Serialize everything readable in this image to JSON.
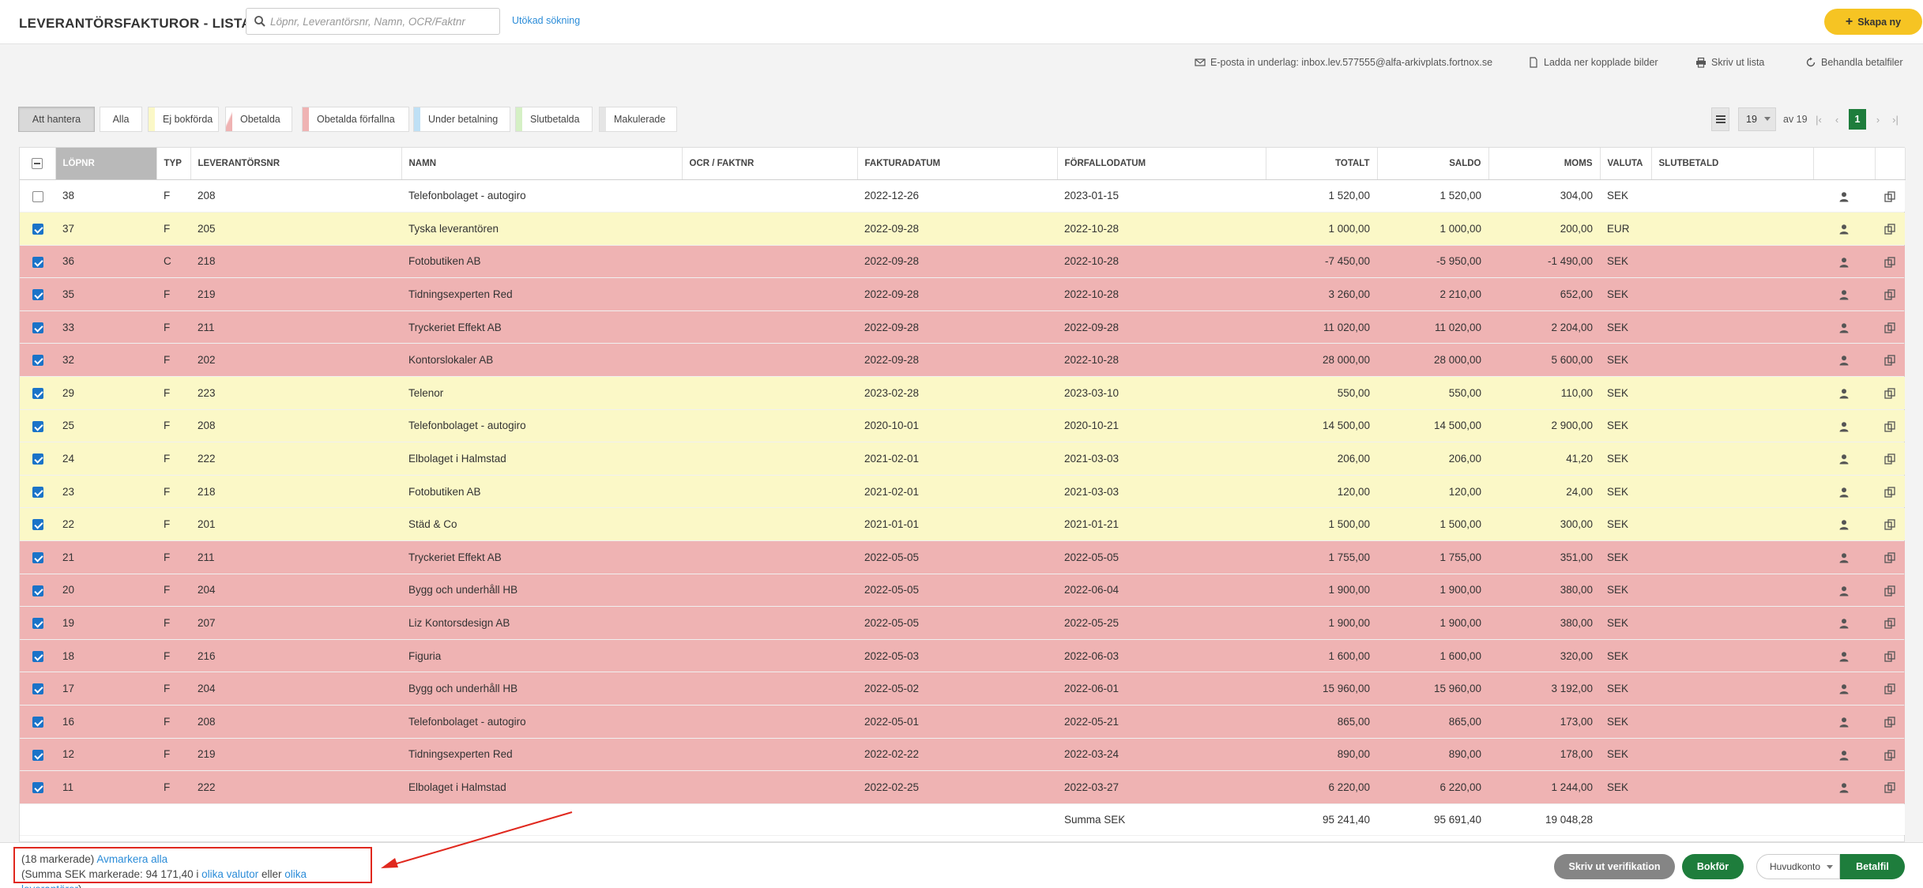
{
  "header": {
    "title": "LEVERANTÖRSFAKTUROR - LISTA",
    "search_placeholder": "Löpnr, Leverantörsnr, Namn, OCR/Faktnr",
    "advanced_search": "Utökad sökning",
    "create_label": "Skapa ny"
  },
  "actions": {
    "email": "E-posta in underlag: inbox.lev.577555@alfa-arkivplats.fortnox.se",
    "download": "Ladda ner kopplade bilder",
    "print": "Skriv ut lista",
    "paymentfiles": "Behandla betalfiler"
  },
  "filters": [
    {
      "label": "Att hantera",
      "color": ""
    },
    {
      "label": "Alla",
      "color": ""
    },
    {
      "label": "Ej bokförda",
      "color": "#fbf8c7"
    },
    {
      "label": "Obetalda",
      "color": "#f4d6d6"
    },
    {
      "label": "Obetalda förfallna",
      "color": "#efb3b3"
    },
    {
      "label": "Under betalning",
      "color": "#bfe0f5"
    },
    {
      "label": "Slutbetalda",
      "color": "#d5f0c5"
    },
    {
      "label": "Makulerade",
      "color": "#e5e5e5"
    }
  ],
  "pagination": {
    "per_page": "19",
    "of_label": "av 19",
    "current": "1"
  },
  "table": {
    "columns": [
      "LÖPNR",
      "TYP",
      "LEVERANTÖRSNR",
      "NAMN",
      "OCR / FAKTNR",
      "FAKTURADATUM",
      "FÖRFALLODATUM",
      "TOTALT",
      "SALDO",
      "MOMS",
      "VALUTA",
      "SLUTBETALD"
    ],
    "rows": [
      {
        "checked": false,
        "status": "white",
        "lopnr": "38",
        "typ": "F",
        "levnr": "208",
        "namn": "Telefonbolaget - autogiro",
        "ocr": "",
        "fakturadatum": "2022-12-26",
        "forfallodatum": "2023-01-15",
        "totalt": "1 520,00",
        "saldo": "1 520,00",
        "moms": "304,00",
        "valuta": "SEK",
        "slutbetald": ""
      },
      {
        "checked": true,
        "status": "yellow",
        "lopnr": "37",
        "typ": "F",
        "levnr": "205",
        "namn": "Tyska leverantören",
        "ocr": "",
        "fakturadatum": "2022-09-28",
        "forfallodatum": "2022-10-28",
        "totalt": "1 000,00",
        "saldo": "1 000,00",
        "moms": "200,00",
        "valuta": "EUR",
        "slutbetald": ""
      },
      {
        "checked": true,
        "status": "red",
        "lopnr": "36",
        "typ": "C",
        "levnr": "218",
        "namn": "Fotobutiken AB",
        "ocr": "",
        "fakturadatum": "2022-09-28",
        "forfallodatum": "2022-10-28",
        "totalt": "-7 450,00",
        "saldo": "-5 950,00",
        "moms": "-1 490,00",
        "valuta": "SEK",
        "slutbetald": ""
      },
      {
        "checked": true,
        "status": "red",
        "lopnr": "35",
        "typ": "F",
        "levnr": "219",
        "namn": "Tidningsexperten Red",
        "ocr": "",
        "fakturadatum": "2022-09-28",
        "forfallodatum": "2022-10-28",
        "totalt": "3 260,00",
        "saldo": "2 210,00",
        "moms": "652,00",
        "valuta": "SEK",
        "slutbetald": ""
      },
      {
        "checked": true,
        "status": "red",
        "lopnr": "33",
        "typ": "F",
        "levnr": "211",
        "namn": "Tryckeriet Effekt AB",
        "ocr": "",
        "fakturadatum": "2022-09-28",
        "forfallodatum": "2022-09-28",
        "totalt": "11 020,00",
        "saldo": "11 020,00",
        "moms": "2 204,00",
        "valuta": "SEK",
        "slutbetald": ""
      },
      {
        "checked": true,
        "status": "red",
        "lopnr": "32",
        "typ": "F",
        "levnr": "202",
        "namn": "Kontorslokaler AB",
        "ocr": "",
        "fakturadatum": "2022-09-28",
        "forfallodatum": "2022-10-28",
        "totalt": "28 000,00",
        "saldo": "28 000,00",
        "moms": "5 600,00",
        "valuta": "SEK",
        "slutbetald": ""
      },
      {
        "checked": true,
        "status": "yellow",
        "lopnr": "29",
        "typ": "F",
        "levnr": "223",
        "namn": "Telenor",
        "ocr": "",
        "fakturadatum": "2023-02-28",
        "forfallodatum": "2023-03-10",
        "totalt": "550,00",
        "saldo": "550,00",
        "moms": "110,00",
        "valuta": "SEK",
        "slutbetald": ""
      },
      {
        "checked": true,
        "status": "yellow",
        "lopnr": "25",
        "typ": "F",
        "levnr": "208",
        "namn": "Telefonbolaget - autogiro",
        "ocr": "",
        "fakturadatum": "2020-10-01",
        "forfallodatum": "2020-10-21",
        "totalt": "14 500,00",
        "saldo": "14 500,00",
        "moms": "2 900,00",
        "valuta": "SEK",
        "slutbetald": ""
      },
      {
        "checked": true,
        "status": "yellow",
        "lopnr": "24",
        "typ": "F",
        "levnr": "222",
        "namn": "Elbolaget i Halmstad",
        "ocr": "",
        "fakturadatum": "2021-02-01",
        "forfallodatum": "2021-03-03",
        "totalt": "206,00",
        "saldo": "206,00",
        "moms": "41,20",
        "valuta": "SEK",
        "slutbetald": ""
      },
      {
        "checked": true,
        "status": "yellow",
        "lopnr": "23",
        "typ": "F",
        "levnr": "218",
        "namn": "Fotobutiken AB",
        "ocr": "",
        "fakturadatum": "2021-02-01",
        "forfallodatum": "2021-03-03",
        "totalt": "120,00",
        "saldo": "120,00",
        "moms": "24,00",
        "valuta": "SEK",
        "slutbetald": ""
      },
      {
        "checked": true,
        "status": "yellow",
        "lopnr": "22",
        "typ": "F",
        "levnr": "201",
        "namn": "Städ & Co",
        "ocr": "",
        "fakturadatum": "2021-01-01",
        "forfallodatum": "2021-01-21",
        "totalt": "1 500,00",
        "saldo": "1 500,00",
        "moms": "300,00",
        "valuta": "SEK",
        "slutbetald": ""
      },
      {
        "checked": true,
        "status": "red",
        "lopnr": "21",
        "typ": "F",
        "levnr": "211",
        "namn": "Tryckeriet Effekt AB",
        "ocr": "",
        "fakturadatum": "2022-05-05",
        "forfallodatum": "2022-05-05",
        "totalt": "1 755,00",
        "saldo": "1 755,00",
        "moms": "351,00",
        "valuta": "SEK",
        "slutbetald": ""
      },
      {
        "checked": true,
        "status": "red",
        "lopnr": "20",
        "typ": "F",
        "levnr": "204",
        "namn": "Bygg och underhåll HB",
        "ocr": "",
        "fakturadatum": "2022-05-05",
        "forfallodatum": "2022-06-04",
        "totalt": "1 900,00",
        "saldo": "1 900,00",
        "moms": "380,00",
        "valuta": "SEK",
        "slutbetald": ""
      },
      {
        "checked": true,
        "status": "red",
        "lopnr": "19",
        "typ": "F",
        "levnr": "207",
        "namn": "Liz Kontorsdesign AB",
        "ocr": "",
        "fakturadatum": "2022-05-05",
        "forfallodatum": "2022-05-25",
        "totalt": "1 900,00",
        "saldo": "1 900,00",
        "moms": "380,00",
        "valuta": "SEK",
        "slutbetald": ""
      },
      {
        "checked": true,
        "status": "red",
        "lopnr": "18",
        "typ": "F",
        "levnr": "216",
        "namn": "Figuria",
        "ocr": "",
        "fakturadatum": "2022-05-03",
        "forfallodatum": "2022-06-03",
        "totalt": "1 600,00",
        "saldo": "1 600,00",
        "moms": "320,00",
        "valuta": "SEK",
        "slutbetald": ""
      },
      {
        "checked": true,
        "status": "red",
        "lopnr": "17",
        "typ": "F",
        "levnr": "204",
        "namn": "Bygg och underhåll HB",
        "ocr": "",
        "fakturadatum": "2022-05-02",
        "forfallodatum": "2022-06-01",
        "totalt": "15 960,00",
        "saldo": "15 960,00",
        "moms": "3 192,00",
        "valuta": "SEK",
        "slutbetald": ""
      },
      {
        "checked": true,
        "status": "red",
        "lopnr": "16",
        "typ": "F",
        "levnr": "208",
        "namn": "Telefonbolaget - autogiro",
        "ocr": "",
        "fakturadatum": "2022-05-01",
        "forfallodatum": "2022-05-21",
        "totalt": "865,00",
        "saldo": "865,00",
        "moms": "173,00",
        "valuta": "SEK",
        "slutbetald": ""
      },
      {
        "checked": true,
        "status": "red",
        "lopnr": "12",
        "typ": "F",
        "levnr": "219",
        "namn": "Tidningsexperten Red",
        "ocr": "",
        "fakturadatum": "2022-02-22",
        "forfallodatum": "2022-03-24",
        "totalt": "890,00",
        "saldo": "890,00",
        "moms": "178,00",
        "valuta": "SEK",
        "slutbetald": ""
      },
      {
        "checked": true,
        "status": "red",
        "lopnr": "11",
        "typ": "F",
        "levnr": "222",
        "namn": "Elbolaget i Halmstad",
        "ocr": "",
        "fakturadatum": "2022-02-25",
        "forfallodatum": "2022-03-27",
        "totalt": "6 220,00",
        "saldo": "6 220,00",
        "moms": "1 244,00",
        "valuta": "SEK",
        "slutbetald": ""
      }
    ],
    "summary": {
      "label": "Summa SEK",
      "totalt": "95 241,40",
      "saldo": "95 691,40",
      "moms": "19 048,28"
    }
  },
  "selection": {
    "count_text": "(18 markerade)",
    "deselect_all": "Avmarkera alla",
    "sum_prefix": "(Summa SEK markerade: 94 171,40 i",
    "currencies_link": "olika valutor",
    "or_text": "eller",
    "suppliers_link": "olika leverantörer",
    "sum_suffix": ")"
  },
  "bottom_actions": {
    "print_verification": "Skriv ut verifikation",
    "book": "Bokför",
    "account": "Huvudkonto",
    "payment_file": "Betalfil"
  },
  "colors": {
    "accent_yellow": "#f6c423",
    "primary_green": "#1e7d3c",
    "link_blue": "#2b8cd8",
    "row_yellow": "#fbf8c7",
    "row_red": "#efb3b3",
    "highlight_red": "#e0281e"
  },
  "icons": {
    "search": "search-icon",
    "create": "plus-icon",
    "email": "envelope-icon",
    "download": "document-icon",
    "print": "printer-icon",
    "paymentfiles": "refresh-icon",
    "row_user": "user-icon",
    "row_copy": "copy-icon"
  }
}
